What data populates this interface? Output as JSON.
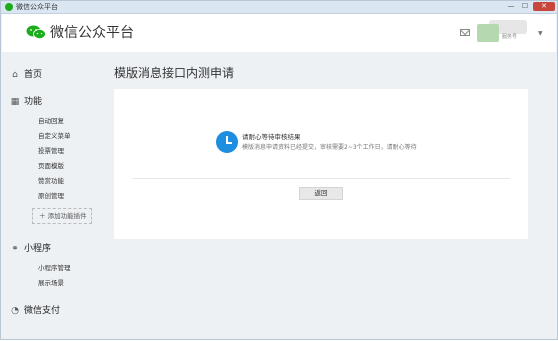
{
  "window": {
    "title": "微信公众平台",
    "controls": {
      "minimize": "—",
      "maximize": "☐",
      "close": "✕"
    }
  },
  "header": {
    "logo_text": "微信公众平台",
    "account_name": "服务号",
    "icons": [
      "wechat-logo-icon",
      "mail-icon",
      "dropdown-caret-icon"
    ]
  },
  "sidebar": {
    "home": {
      "label": "首页",
      "icon": "home-icon"
    },
    "function": {
      "label": "功能",
      "icon": "grid-icon",
      "items": [
        "自动回复",
        "自定义菜单",
        "投票管理",
        "页面模版",
        "赞赏功能",
        "原创管理"
      ],
      "add_plugin": "＋ 添加功能插件"
    },
    "miniprogram": {
      "label": "小程序",
      "icon": "link-icon",
      "items": [
        "小程序管理",
        "展示场景"
      ]
    },
    "wechat_pay": {
      "label": "微信支付",
      "icon": "pay-icon"
    }
  },
  "main": {
    "page_title": "模版消息接口内测申请",
    "status_title": "请耐心等待审核结果",
    "status_desc": "模版消息申请资料已经提交，审核需要2~3个工作日，请耐心等待",
    "back_button": "返回",
    "status_icon": "clock-icon"
  },
  "colors": {
    "accent": "#1e8ee0",
    "brand": "#1aad19",
    "close": "#c9463d"
  }
}
